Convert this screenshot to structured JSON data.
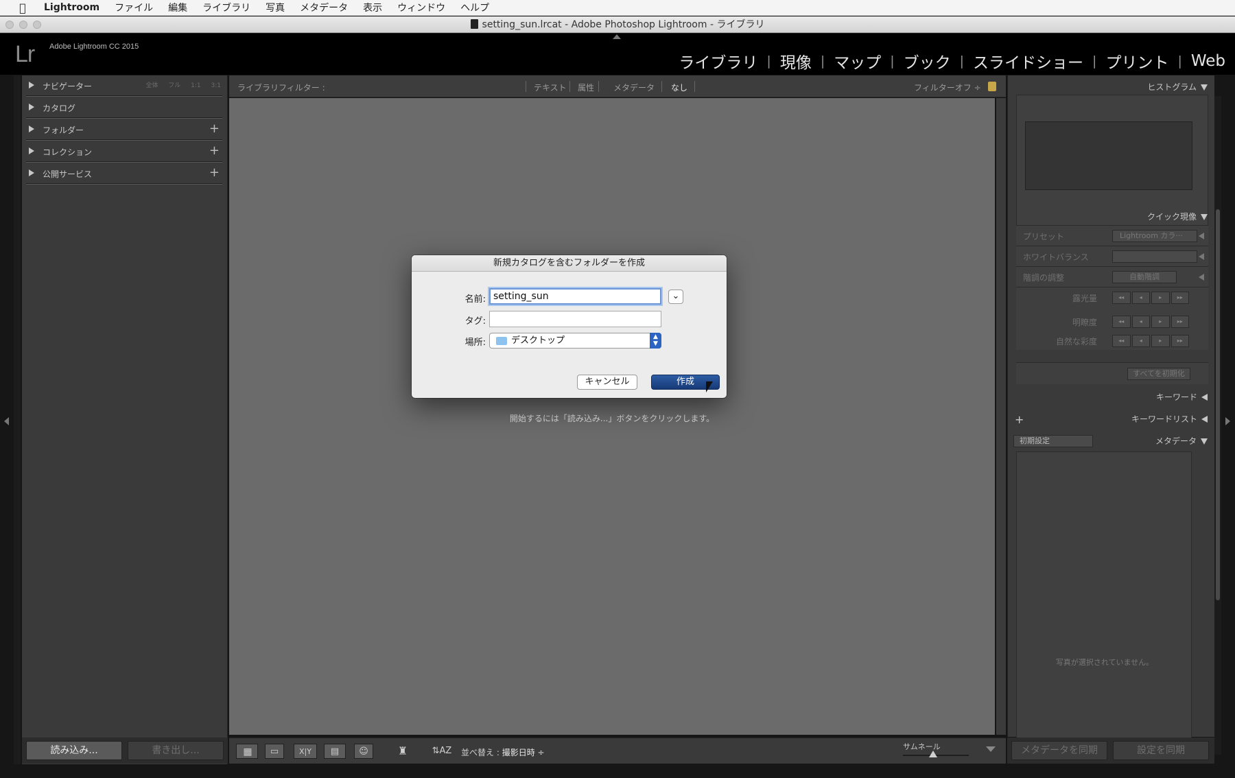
{
  "menubar": {
    "items": [
      "Lightroom",
      "ファイル",
      "編集",
      "ライブラリ",
      "写真",
      "メタデータ",
      "表示",
      "ウィンドウ",
      "ヘルプ"
    ]
  },
  "window": {
    "title": "setting_sun.lrcat - Adobe Photoshop Lightroom - ライブラリ"
  },
  "identity": {
    "logo": "Lr",
    "product": "Adobe Lightroom CC 2015"
  },
  "modules": [
    "ライブラリ",
    "現像",
    "マップ",
    "ブック",
    "スライドショー",
    "プリント",
    "Web"
  ],
  "left_panel": {
    "navigator": {
      "label": "ナビゲーター",
      "sizes": "全体 フル 1:1 3:1"
    },
    "catalog": {
      "label": "カタログ"
    },
    "folders": {
      "label": "フォルダー",
      "add": "+"
    },
    "collections": {
      "label": "コレクション",
      "add": "+"
    },
    "publish": {
      "label": "公開サービス",
      "add": "+"
    },
    "import_label": "読み込み...",
    "export_label": "書き出し..."
  },
  "filter_bar": {
    "label": "ライブラリフィルター :",
    "text": "テキスト",
    "attribute": "属性",
    "metadata": "メタデータ",
    "none": "なし",
    "filters_off": "フィルターオフ ÷"
  },
  "center": {
    "hint": "開始するには「読み込み...」ボタンをクリックします。"
  },
  "toolbar": {
    "sort_label": "並べ替え :",
    "sort_value": "撮影日時 ÷",
    "thumbnail_label": "サムネール",
    "compare_label": "X|Y"
  },
  "right_panel": {
    "histogram": "ヒストグラム",
    "quick_develop": "クイック現像",
    "preset_label": "プリセット",
    "preset_value": "Lightroom カラ···",
    "white_balance_label": "ホワイトバランス",
    "tone_label": "階調の調整",
    "auto_tone": "自動階調",
    "exposure_label": "露光量",
    "clarity_label": "明瞭度",
    "vibrance_label": "自然な彩度",
    "reset_all": "すべてを初期化",
    "keywording": "キーワード",
    "keyword_list": "キーワードリスト",
    "metadata": "メタデータ",
    "metadata_preset": "初期設定",
    "no_selection": "写真が選択されていません。",
    "sync_metadata": "メタデータを同期",
    "sync_settings": "設定を同期"
  },
  "dialog": {
    "title": "新規カタログを含むフォルダーを作成",
    "name_label": "名前:",
    "name_value": "setting_sun",
    "tag_label": "タグ:",
    "tag_value": "",
    "location_label": "場所:",
    "location_value": "デスクトップ",
    "cancel_label": "キャンセル",
    "create_label": "作成"
  },
  "colors": {
    "accent": "#1f4a8f",
    "panel": "#3a3a3a",
    "center": "#6b6b6b"
  }
}
